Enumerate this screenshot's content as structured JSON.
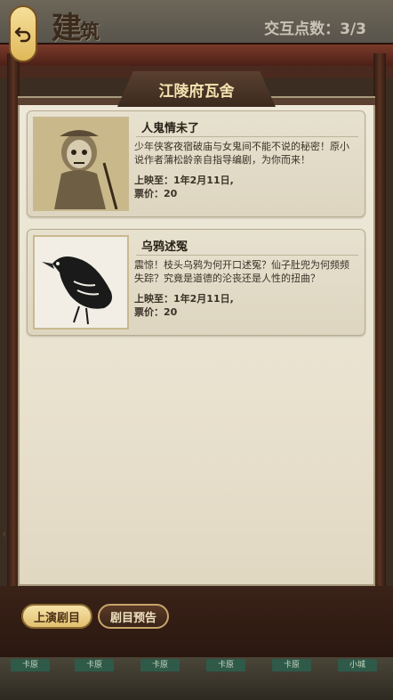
{
  "header": {
    "title_main": "建",
    "title_small": "筑",
    "points_label": "交互点数：3/3"
  },
  "venue": {
    "name": "江陵府瓦舍"
  },
  "plays": [
    {
      "title": "人鬼情未了",
      "description": "少年侠客夜宿破庙与女鬼间不能不说的秘密！原小说作者蒲松龄亲自指导编剧，为你而来！",
      "showing_until": "上映至：1年2月11日,",
      "price": "票价：20"
    },
    {
      "title": "乌鸦述冤",
      "description": "震惊！枝头乌鸦为何开口述冤？仙子肚兜为何频频失踪？究竟是道德的沦丧还是人性的扭曲？",
      "showing_until": "上映至：1年2月11日,",
      "price": "票价：20"
    }
  ],
  "buttons": {
    "current_plays": "上演剧目",
    "preview_plays": "剧目预告"
  },
  "bottom_tabs": [
    "卡原",
    "卡原",
    "卡原",
    "卡原",
    "卡原",
    "小城"
  ],
  "colors": {
    "accent": "#e2c070",
    "panel": "#e9e2cf",
    "frame": "#4b2016"
  }
}
